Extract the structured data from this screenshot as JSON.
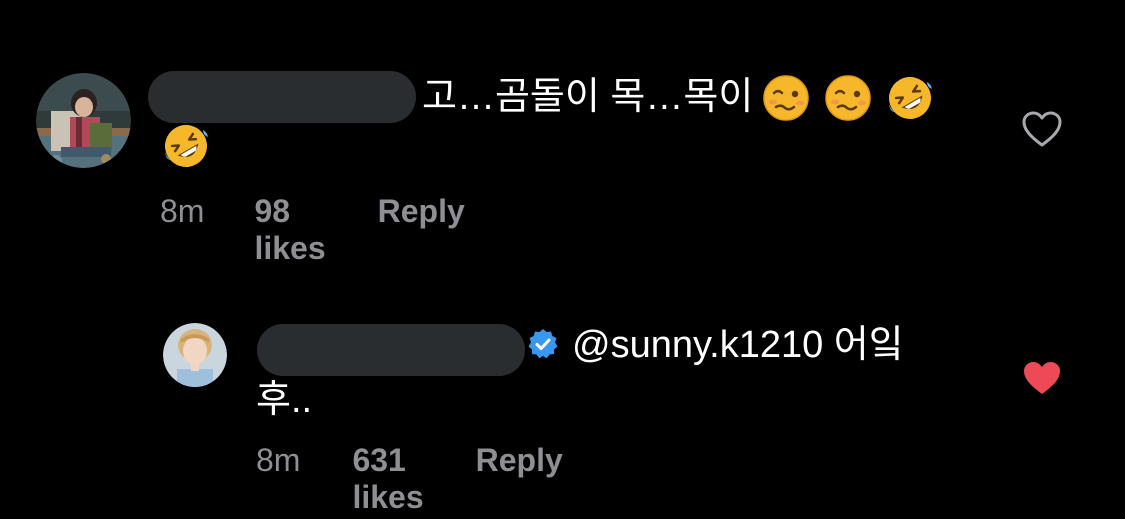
{
  "comments": [
    {
      "text_line1": "고…곰돌이 목…목이",
      "emojis": [
        "woozy-face",
        "woozy-face",
        "rolling-on-floor-laughing"
      ],
      "emoji_line2": "rolling-on-floor-laughing",
      "time": "8m",
      "likes": "98 likes",
      "reply": "Reply",
      "liked": false
    },
    {
      "text_line1": "@sunny.k1210 어잌",
      "text_line2": "후..",
      "time": "8m",
      "likes": "631 likes",
      "reply": "Reply",
      "liked": true,
      "verified": true
    }
  ],
  "colors": {
    "background": "#000000",
    "text": "#ffffff",
    "meta": "#8e8e93",
    "redaction": "#2a2d30",
    "heart_liked": "#ed4956",
    "verified_blue": "#3897f0"
  }
}
